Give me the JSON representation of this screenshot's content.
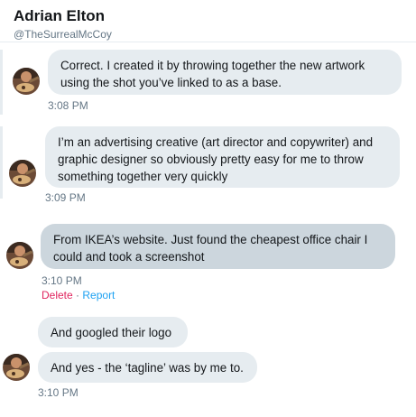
{
  "header": {
    "name": "Adrian Elton",
    "handle": "@TheSurrealMcCoy"
  },
  "messages": [
    {
      "lines": [
        "Correct. I created it by throwing together the new artwork",
        "using the shot you’ve linked to as a base."
      ],
      "time": "3:08 PM"
    },
    {
      "lines": [
        "I’m an advertising creative (art director and copywriter) and",
        "graphic designer so obviously pretty easy for me to throw",
        "something together very quickly"
      ],
      "time": "3:09 PM"
    },
    {
      "lines": [
        "From IKEA’s website. Just found the cheapest office chair I",
        "could and took a screenshot"
      ],
      "time": "3:10 PM",
      "actions": {
        "delete": "Delete",
        "separator": "·",
        "report": "Report"
      }
    },
    {
      "lines": [
        "And googled their logo"
      ]
    },
    {
      "lines": [
        "And yes - the ‘tagline’ was by me to."
      ],
      "time": "3:10 PM"
    }
  ],
  "colors": {
    "bubble": "#e6ecf0",
    "bubble_hover": "#ccd6dd",
    "delete": "#e0245e",
    "report": "#1da1f2",
    "muted": "#657786"
  },
  "icons": {
    "avatar": "avatar-image"
  }
}
